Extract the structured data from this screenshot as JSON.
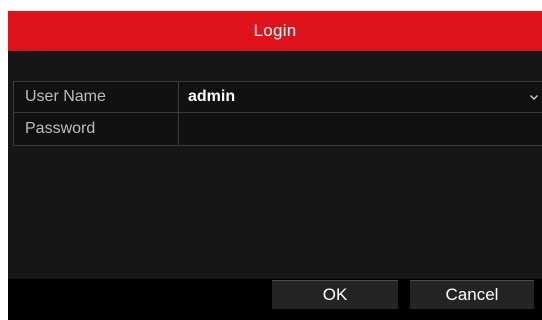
{
  "dialog": {
    "title": "Login",
    "accent_color": "#e0121b"
  },
  "form": {
    "username": {
      "label": "User Name",
      "value": "admin",
      "dropdown_icon": "chevron-down-icon"
    },
    "password": {
      "label": "Password",
      "value": ""
    }
  },
  "buttons": {
    "ok_label": "OK",
    "cancel_label": "Cancel"
  }
}
